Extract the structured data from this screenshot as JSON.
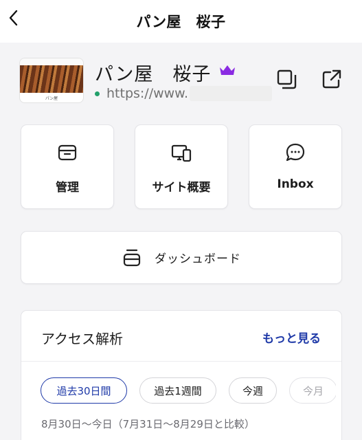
{
  "header": {
    "title": "パン屋　桜子"
  },
  "site": {
    "name": "パン屋　桜子",
    "url": "https://www.",
    "thumbnail_caption": "パン屋",
    "status_color": "#22a06b",
    "plan_badge_color": "#8a2be2"
  },
  "tiles": [
    {
      "label": "管理",
      "icon": "inbox-tray-icon"
    },
    {
      "label": "サイト概要",
      "icon": "devices-icon"
    },
    {
      "label": "Inbox",
      "icon": "chat-bubble-icon"
    }
  ],
  "dashboard": {
    "label": "ダッシュボード",
    "icon": "stack-icon"
  },
  "analytics": {
    "title": "アクセス解析",
    "more_label": "もっと見る",
    "chips": [
      {
        "label": "過去30日間",
        "active": true
      },
      {
        "label": "過去1週間",
        "active": false
      },
      {
        "label": "今週",
        "active": false
      },
      {
        "label": "今月",
        "active": false
      }
    ],
    "range_text": "8月30日～今日（7月31日～8月29日と比較）"
  },
  "colors": {
    "accent": "#1f3aa8",
    "background": "#f4f4f6"
  }
}
